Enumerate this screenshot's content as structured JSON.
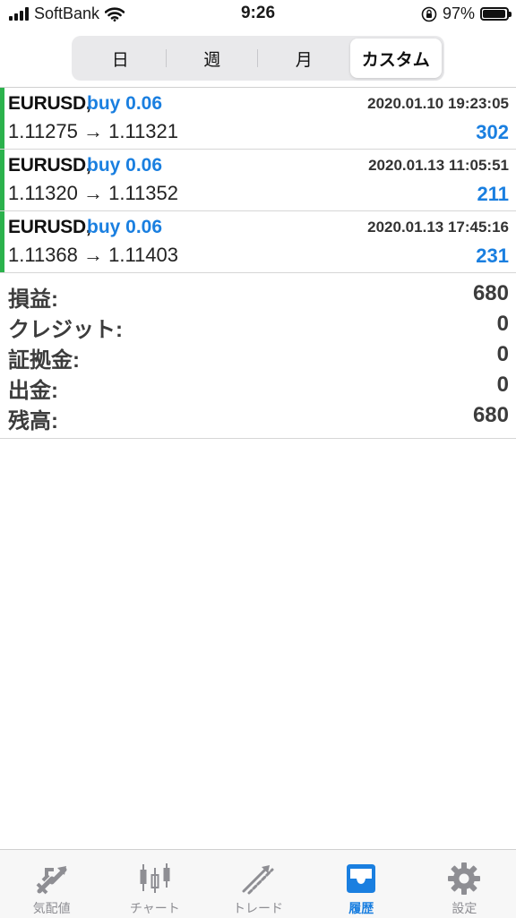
{
  "status_bar": {
    "carrier": "SoftBank",
    "time": "9:26",
    "battery": "97%",
    "battery_level": 0.97
  },
  "period_tabs": [
    {
      "label": "日",
      "selected": false
    },
    {
      "label": "週",
      "selected": false
    },
    {
      "label": "月",
      "selected": false
    },
    {
      "label": "カスタム",
      "selected": true
    }
  ],
  "trades": [
    {
      "symbol": "EURUSD,",
      "side": "buy 0.06",
      "datetime": "2020.01.10 19:23:05",
      "prices": "1.11275 → 1.11321",
      "profit": "302"
    },
    {
      "symbol": "EURUSD,",
      "side": "buy 0.06",
      "datetime": "2020.01.13 11:05:51",
      "prices": "1.11320 → 1.11352",
      "profit": "211"
    },
    {
      "symbol": "EURUSD,",
      "side": "buy 0.06",
      "datetime": "2020.01.13 17:45:16",
      "prices": "1.11368 → 1.11403",
      "profit": "231"
    }
  ],
  "summary": [
    {
      "label": "損益:",
      "value": "680"
    },
    {
      "label": "クレジット:",
      "value": "0"
    },
    {
      "label": "証拠金:",
      "value": "0"
    },
    {
      "label": "出金:",
      "value": "0"
    },
    {
      "label": "残高:",
      "value": "680"
    }
  ],
  "tab_bar": [
    {
      "label": "気配値",
      "icon": "quotes-arrows-icon",
      "active": false
    },
    {
      "label": "チャート",
      "icon": "candlestick-chart-icon",
      "active": false
    },
    {
      "label": "トレード",
      "icon": "trade-trend-icon",
      "active": false
    },
    {
      "label": "履歴",
      "icon": "history-inbox-icon",
      "active": true
    },
    {
      "label": "設定",
      "icon": "settings-gear-icon",
      "active": false
    }
  ],
  "colors": {
    "accent": "#1a7fe0",
    "buy_bar": "#2bb24c",
    "inactive": "#8e8e93"
  }
}
